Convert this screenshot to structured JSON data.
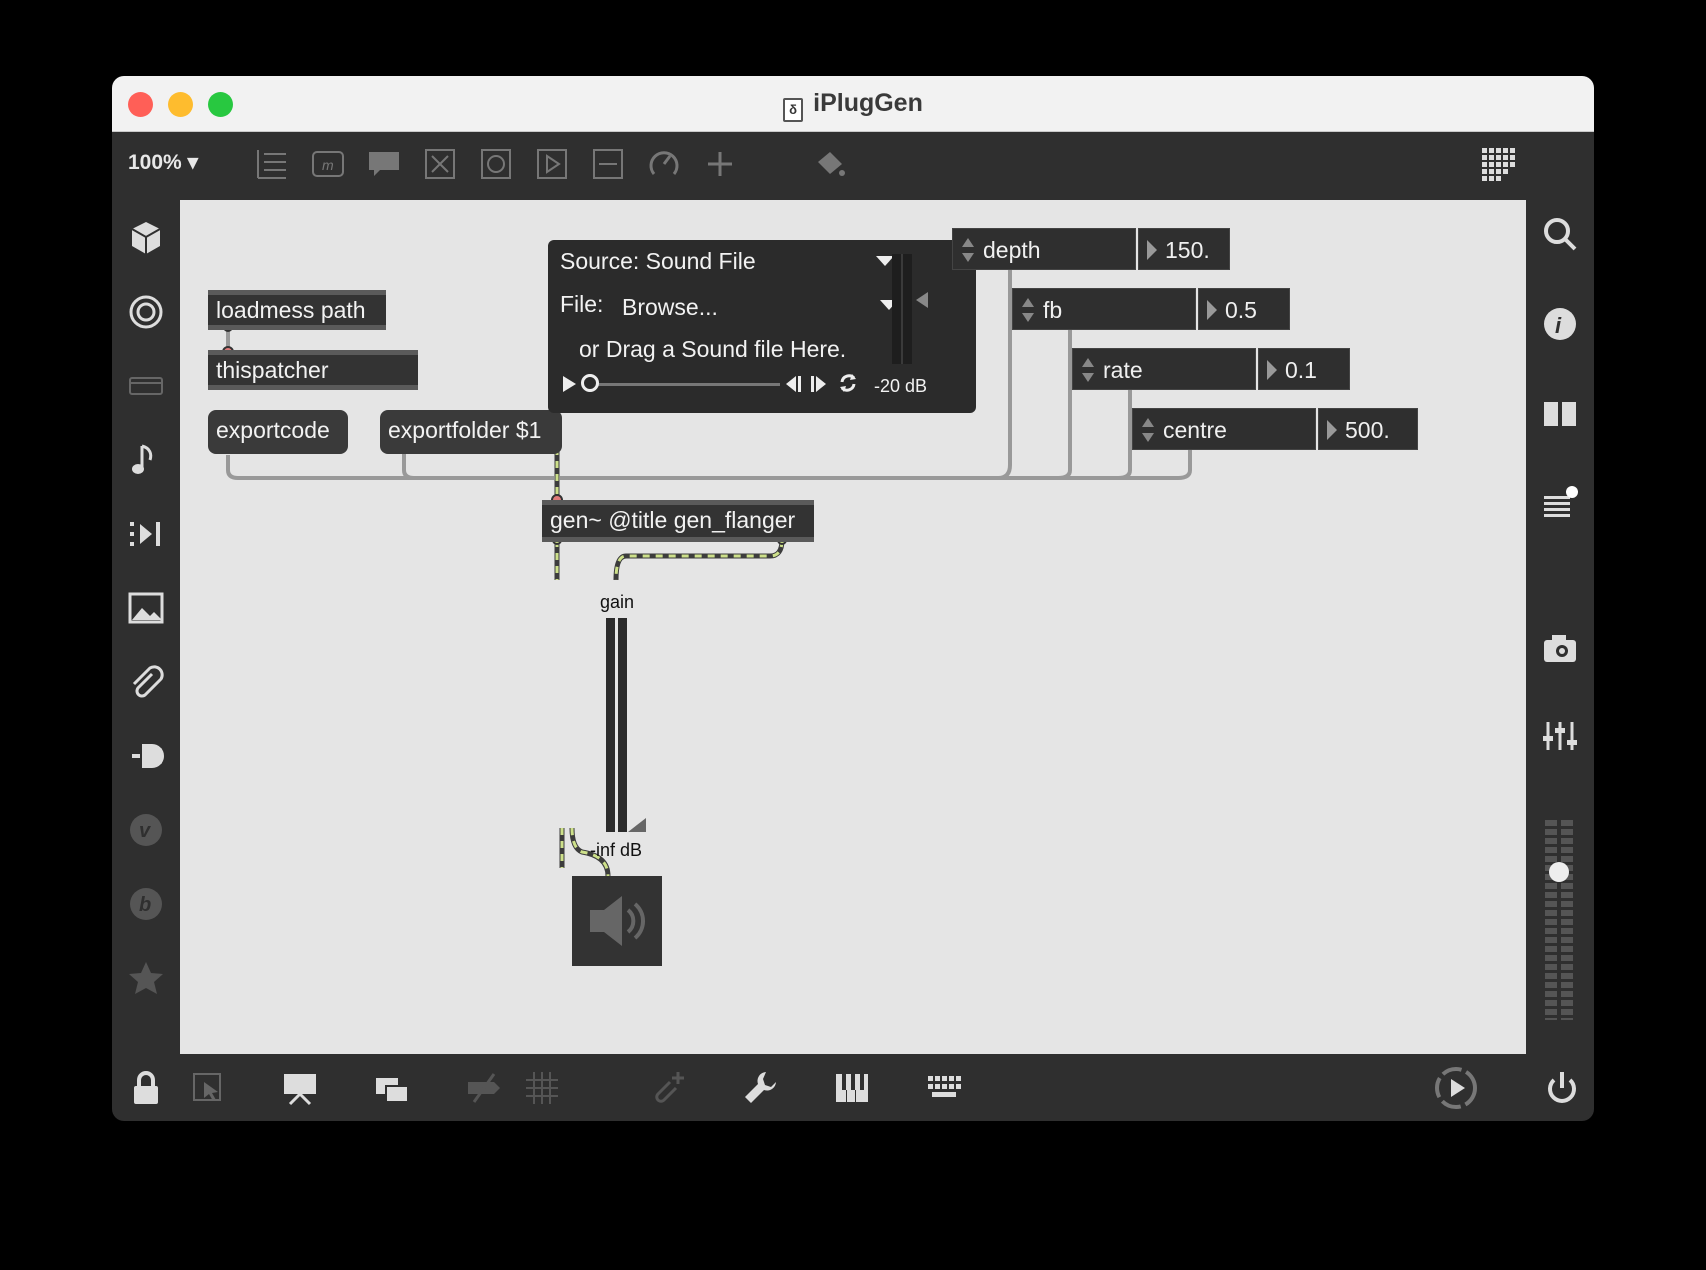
{
  "window": {
    "title": "iPlugGen"
  },
  "toolbar": {
    "zoom": "100%"
  },
  "patch": {
    "loadmess": "loadmess path",
    "thispatcher": "thispatcher",
    "exportcode": "exportcode",
    "exportfolder": "exportfolder $1",
    "gen": "gen~ @title gen_flanger",
    "gain_label": "gain",
    "gain_value": "-inf dB"
  },
  "playlist": {
    "source": "Source: Sound File",
    "file_label": "File:",
    "file_value": "Browse...",
    "drag_hint": "or Drag a Sound file Here.",
    "level": "-20 dB"
  },
  "params": [
    {
      "name": "depth",
      "value": "150."
    },
    {
      "name": "fb",
      "value": "0.5"
    },
    {
      "name": "rate",
      "value": "0.1"
    },
    {
      "name": "centre",
      "value": "500."
    }
  ],
  "icons": {
    "left_sidebar": [
      "cube-icon",
      "target-icon",
      "clip-icon",
      "music-note-icon",
      "step-forward-icon",
      "image-icon",
      "paperclip-icon",
      "plug-icon",
      "v-icon",
      "b-icon",
      "star-icon"
    ],
    "right_sidebar": [
      "search-icon",
      "info-icon",
      "columns-icon",
      "list-icon",
      "camera-icon",
      "mixer-icon"
    ],
    "bottom": [
      "lock-icon",
      "select-icon",
      "presentation-icon",
      "windows-icon",
      "hide-icon",
      "grid-icon",
      "add-clip-icon",
      "wrench-icon",
      "piano-icon",
      "keyboard-icon",
      "dsp-icon",
      "power-icon"
    ]
  }
}
